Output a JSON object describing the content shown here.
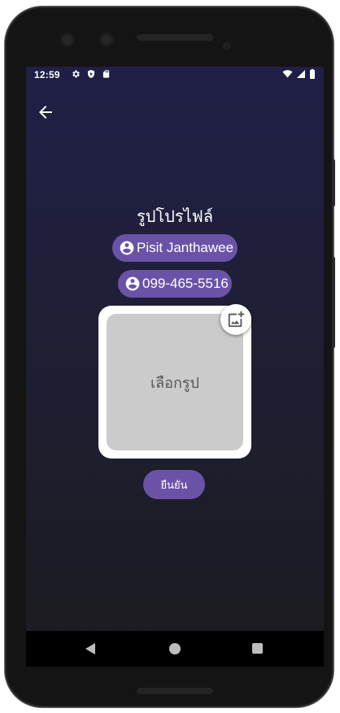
{
  "status_bar": {
    "time": "12:59",
    "left_icons": [
      "gear-icon",
      "play-protect-icon",
      "sd-card-icon"
    ],
    "right_icons": [
      "wifi-icon",
      "signal-icon",
      "battery-icon"
    ]
  },
  "header": {
    "back_icon": "arrow-left-icon"
  },
  "profile": {
    "title": "รูปโปรไฟล์",
    "name": "Pisit Janthawee",
    "phone": "099-465-5516",
    "chip_icon": "account-circle-icon"
  },
  "photo": {
    "placeholder_label": "เลือกรูป",
    "add_icon": "add-photo-icon"
  },
  "actions": {
    "confirm_label": "ยืนยัน"
  },
  "colors": {
    "accent": "#6a53a7",
    "background_top": "#1f1f47",
    "background_bottom": "#1b1b1f",
    "photo_placeholder": "#cbcbcb"
  }
}
